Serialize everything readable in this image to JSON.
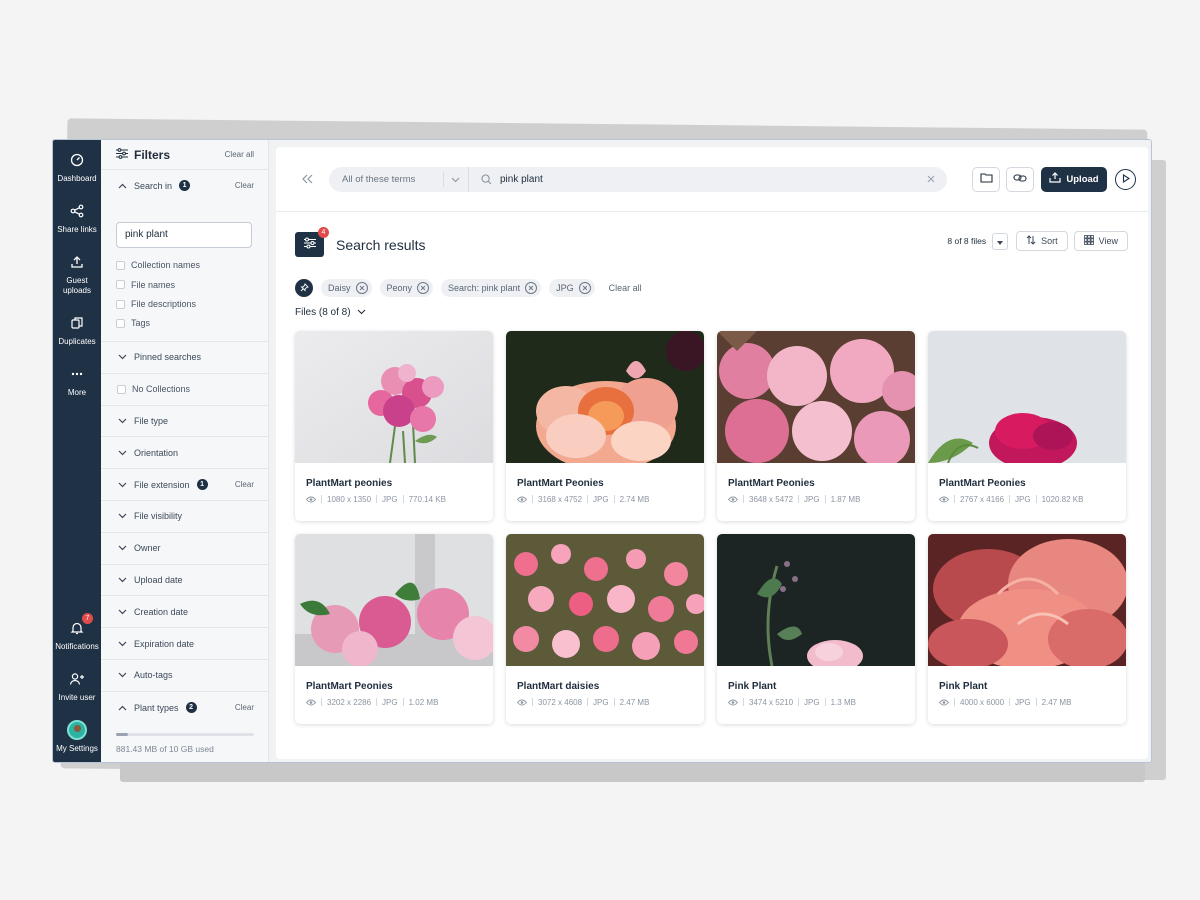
{
  "rail": {
    "dashboard": "Dashboard",
    "share_links": "Share links",
    "guest_uploads": "Guest uploads",
    "duplicates": "Duplicates",
    "more": "More",
    "notifications": "Notifications",
    "notifications_count": "7",
    "invite_user": "Invite user",
    "my_settings": "My Settings"
  },
  "filters": {
    "title": "Filters",
    "clear_all": "Clear all",
    "search_in": {
      "label": "Search in",
      "count": "1",
      "clear": "Clear",
      "value": "pink plant",
      "options": [
        "Collection names",
        "File names",
        "File descriptions",
        "Tags"
      ]
    },
    "pinned_searches": "Pinned searches",
    "no_collections": "No Collections",
    "file_type": "File type",
    "orientation": "Orientation",
    "file_extension": {
      "label": "File extension",
      "count": "1",
      "clear": "Clear"
    },
    "file_visibility": "File visibility",
    "owner": "Owner",
    "upload_date": "Upload date",
    "creation_date": "Creation date",
    "expiration_date": "Expiration date",
    "auto_tags": "Auto-tags",
    "plant_types": {
      "label": "Plant types",
      "count": "2",
      "clear": "Clear"
    },
    "storage": {
      "text": "881.43 MB of 10 GB used",
      "fraction": 0.088
    }
  },
  "topbar": {
    "match_mode": "All of these terms",
    "query": "pink plant",
    "upload": "Upload"
  },
  "results": {
    "title": "Search results",
    "filter_badge": "4",
    "count": "8 of 8 files",
    "sort": "Sort",
    "view": "View",
    "chips": [
      "Daisy",
      "Peony",
      "Search: pink plant",
      "JPG"
    ],
    "clear_all": "Clear all",
    "files_label": "Files (8 of 8)"
  },
  "files": [
    {
      "name": "PlantMart peonies",
      "dims": "1080 x 1350",
      "type": "JPG",
      "size": "770.14 KB"
    },
    {
      "name": "PlantMart Peonies",
      "dims": "3168 x 4752",
      "type": "JPG",
      "size": "2.74 MB"
    },
    {
      "name": "PlantMart Peonies",
      "dims": "3648 x 5472",
      "type": "JPG",
      "size": "1.87 MB"
    },
    {
      "name": "PlantMart Peonies",
      "dims": "2767 x 4166",
      "type": "JPG",
      "size": "1020.82 KB"
    },
    {
      "name": "PlantMart Peonies",
      "dims": "3202 x 2286",
      "type": "JPG",
      "size": "1.02 MB"
    },
    {
      "name": "PlantMart daisies",
      "dims": "3072 x 4608",
      "type": "JPG",
      "size": "2.47 MB"
    },
    {
      "name": "Pink Plant",
      "dims": "3474 x 5210",
      "type": "JPG",
      "size": "1.3 MB"
    },
    {
      "name": "Pink Plant",
      "dims": "4000 x 6000",
      "type": "JPG",
      "size": "2.47 MB"
    }
  ],
  "colors": {
    "navy": "#1f3145",
    "badge_red": "#e24b4b",
    "peony_pink": "#e8799f"
  }
}
